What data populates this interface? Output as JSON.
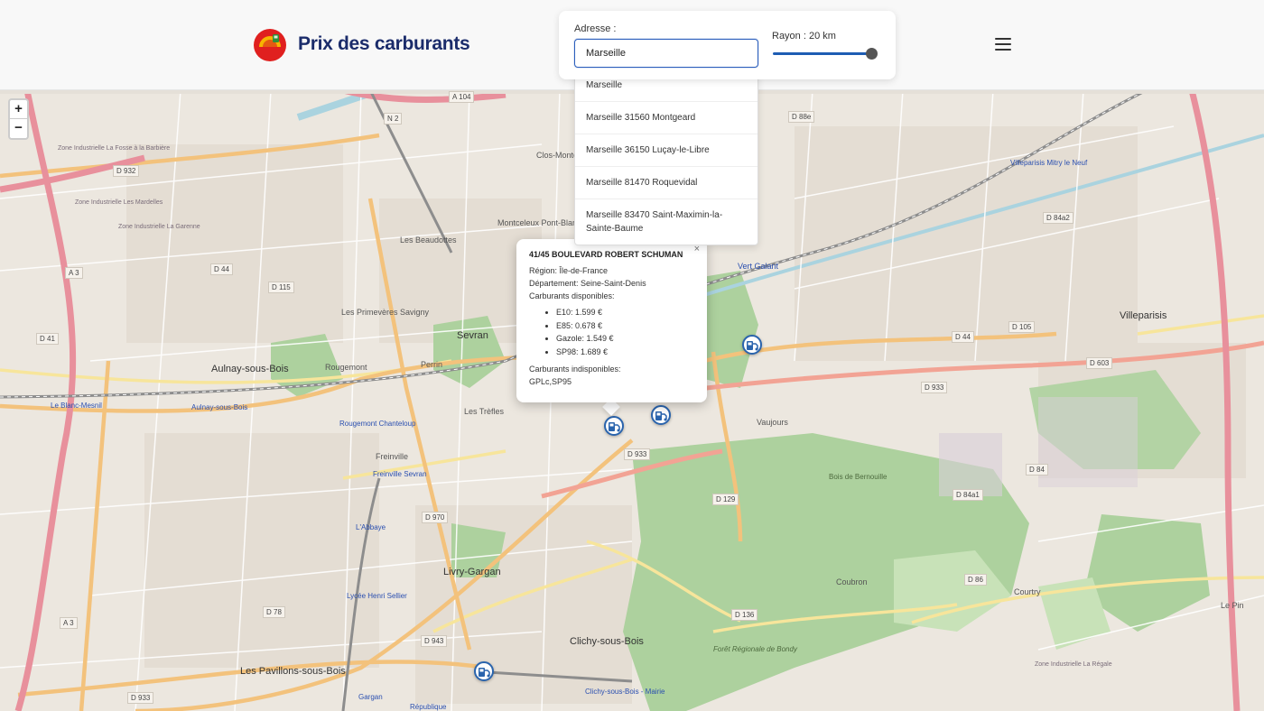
{
  "header": {
    "brand": "Prix des carburants"
  },
  "search": {
    "address_label": "Adresse :",
    "address_value": "Marseille",
    "radius_label": "Rayon : 20 km",
    "radius_fraction": 1.0
  },
  "suggestions": [
    "Marseille",
    "Marseille 31560 Montgeard",
    "Marseille 36150 Luçay-le-Libre",
    "Marseille 81470 Roquevidal",
    "Marseille 83470 Saint-Maximin-la-Sainte-Baume"
  ],
  "map": {
    "zoom_in": "+",
    "zoom_out": "−",
    "labels": {
      "sevran": "Sevran",
      "aulnay": "Aulnay-sous-Bois",
      "villeparisis": "Villeparisis",
      "livry": "Livry-Gargan",
      "clichy": "Clichy-sous-Bois",
      "pavillons": "Les Pavillons-sous-Bois",
      "coubron": "Coubron",
      "courtry": "Courtry",
      "vaujours": "Vaujours",
      "rougemont": "Rougemont",
      "beaudottes": "Les Beaudottes",
      "primeveres": "Les Primevères Savigny",
      "perrin": "Perrin",
      "freinville": "Freinville",
      "tréfles": "Les Trèfles",
      "montceleux": "Montceleux Pont-Blanc",
      "vert_galant": "Vert Galant",
      "clos_montceleux": "Clos-Montceleux",
      "lepin": "Le Pin",
      "blanc_mesnil": "Le Blanc-Mesnil",
      "gare_aulnay": "Aulnay-sous-Bois",
      "rougemont_chanteloup": "Rougemont Chanteloup",
      "freinville_sevran": "Freinville Sevran",
      "abbaye": "L'Abbaye",
      "gargan": "Gargan",
      "republique": "République",
      "zi1": "Zone Industrielle La Fosse à la Barbière",
      "zi2": "Zone Industrielle Les Mardelles",
      "zi3": "Zone Industrielle La Garenne",
      "zi4": "Zone Industrielle La Régale",
      "bois_bernouille": "Bois de Bernouille",
      "foret_bondy": "Forêt Régionale de Bondy",
      "villeparisis_mitry": "Villeparisis Mitry le Neuf",
      "lycee": "Lycée Henri Sellier",
      "clichy_mairie": "Clichy-sous-Bois - Mairie"
    },
    "roads": {
      "a104": "A 104",
      "n2": "N 2",
      "d932": "D 932",
      "d44": "D 44",
      "d115": "D 115",
      "d41": "D 41",
      "a3": "A 3",
      "a3b": "A 3",
      "d88e": "D 88e",
      "d84a2": "D 84a2",
      "d105": "D 105",
      "d44b": "D 44",
      "d603": "D 603",
      "d933": "D 933",
      "d933b": "D 933",
      "d84": "D 84",
      "d84a1": "D 84a1",
      "d129": "D 129",
      "d970": "D 970",
      "d78": "D 78",
      "d943": "D 943",
      "d136": "D 136",
      "d86": "D 86",
      "d933c": "D 933"
    }
  },
  "popup": {
    "close": "×",
    "title": "41/45 BOULEVARD ROBERT SCHUMAN",
    "region": "Région: Île-de-France",
    "departement": "Département: Seine-Saint-Denis",
    "available_label": "Carburants disponibles:",
    "fuels": [
      "E10: 1.599 €",
      "E85: 0.678 €",
      "Gazole: 1.549 €",
      "SP98: 1.689 €"
    ],
    "unavailable_label": "Carburants indisponibles:",
    "unavailable": "GPLc,SP95"
  },
  "colors": {
    "brand": "#1b2c6b",
    "accent": "#2b5ebc",
    "motorway": "#e8909c",
    "primary_road": "#f3c27c",
    "forest": "#add19e",
    "water": "#aad3df"
  },
  "icons": {
    "logo": "fuel-logo-icon",
    "menu": "hamburger-menu-icon",
    "station": "fuel-station-icon"
  }
}
